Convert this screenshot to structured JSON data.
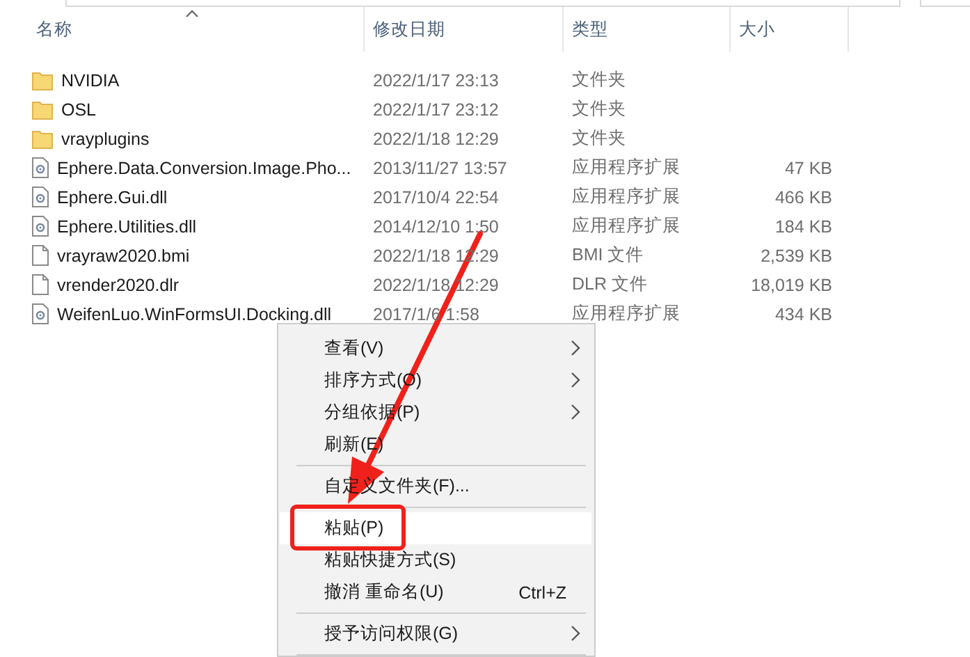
{
  "columns": [
    {
      "label": "名称",
      "sorted": true
    },
    {
      "label": "修改日期",
      "sorted": false
    },
    {
      "label": "类型",
      "sorted": false
    },
    {
      "label": "大小",
      "sorted": false
    }
  ],
  "files": [
    {
      "kind": "folder",
      "name": "NVIDIA",
      "date": "2022/1/17 23:13",
      "type": "文件夹"
    },
    {
      "kind": "folder",
      "name": "OSL",
      "date": "2022/1/17 23:12",
      "type": "文件夹"
    },
    {
      "kind": "folder",
      "name": "vrayplugins",
      "date": "2022/1/18 12:29",
      "type": "文件夹"
    },
    {
      "kind": "dll",
      "name": "Ephere.Data.Conversion.Image.Pho...",
      "date": "2013/11/27 13:57",
      "type": "应用程序扩展",
      "size": "47 KB"
    },
    {
      "kind": "dll",
      "name": "Ephere.Gui.dll",
      "date": "2017/10/4 22:54",
      "type": "应用程序扩展",
      "size": "466 KB"
    },
    {
      "kind": "dll",
      "name": "Ephere.Utilities.dll",
      "date": "2014/12/10 1:50",
      "type": "应用程序扩展",
      "size": "184 KB"
    },
    {
      "kind": "file",
      "name": "vrayraw2020.bmi",
      "date": "2022/1/18 12:29",
      "type": "BMI 文件",
      "size": "2,539 KB"
    },
    {
      "kind": "file",
      "name": "vrender2020.dlr",
      "date": "2022/1/18 12:29",
      "type": "DLR 文件",
      "size": "18,019 KB"
    },
    {
      "kind": "dll",
      "name": "WeifenLuo.WinFormsUI.Docking.dll",
      "date": "2017/1/6 1:58",
      "type": "应用程序扩展",
      "size": "434 KB"
    }
  ],
  "context_menu": [
    {
      "kind": "item",
      "label": "查看(V)",
      "submenu": true,
      "selected": false
    },
    {
      "kind": "item",
      "label": "排序方式(O)",
      "submenu": true,
      "selected": false
    },
    {
      "kind": "item",
      "label": "分组依据(P)",
      "submenu": true,
      "selected": false
    },
    {
      "kind": "item",
      "label": "刷新(E)",
      "submenu": false,
      "selected": false
    },
    {
      "kind": "separator"
    },
    {
      "kind": "item",
      "label": "自定义文件夹(F)...",
      "submenu": false,
      "selected": false
    },
    {
      "kind": "separator"
    },
    {
      "kind": "item",
      "label": "粘贴(P)",
      "submenu": false,
      "selected": true
    },
    {
      "kind": "item",
      "label": "粘贴快捷方式(S)",
      "submenu": false,
      "selected": false
    },
    {
      "kind": "item",
      "label": "撤消 重命名(U)",
      "shortcut": "Ctrl+Z",
      "submenu": false,
      "selected": false
    },
    {
      "kind": "separator"
    },
    {
      "kind": "item",
      "label": "授予访问权限(G)",
      "submenu": true,
      "selected": false
    },
    {
      "kind": "separator"
    }
  ]
}
